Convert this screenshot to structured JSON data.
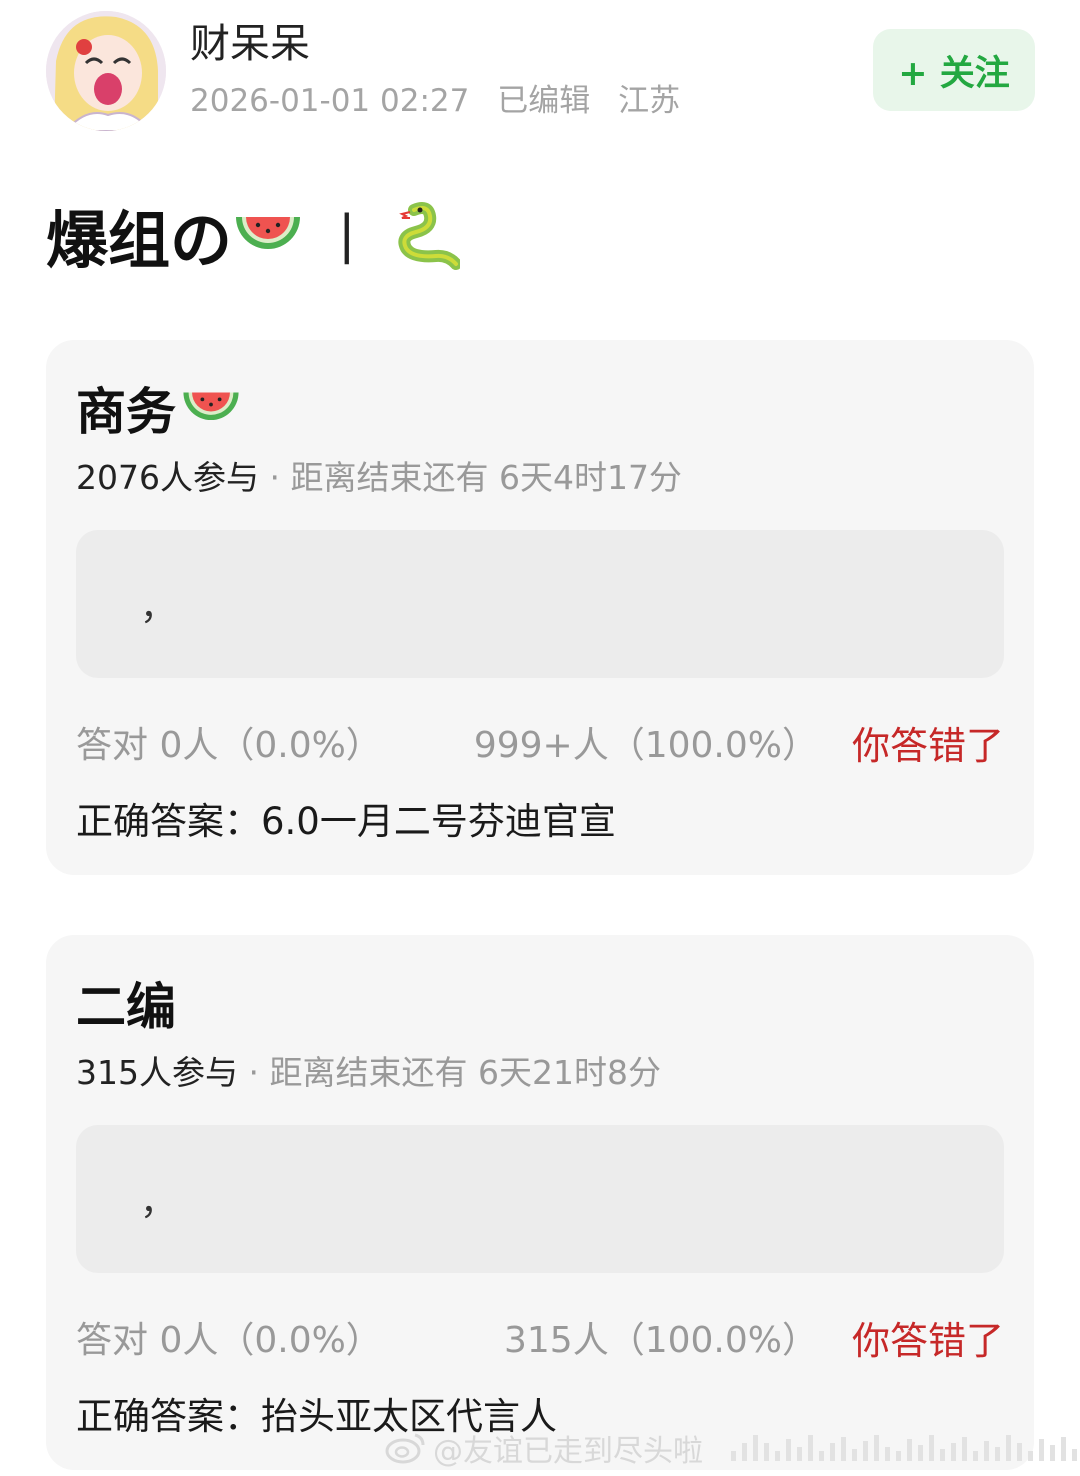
{
  "author": {
    "name": "财呆呆",
    "timestamp": "2026-01-01 02:27",
    "edited_label": "已编辑",
    "location": "江苏",
    "avatar_icon": "anime-girl-avatar"
  },
  "follow_button": {
    "label": "+ 关注",
    "color": "#23a841"
  },
  "post": {
    "title_text": "爆组の",
    "title_icons": [
      "watermelon-emoji",
      "snake-emoji"
    ],
    "separator": "|"
  },
  "quizzes": [
    {
      "title": "商务",
      "title_icon": "watermelon-emoji",
      "participants": "2076人参与",
      "remaining": "· 距离结束还有 6天4时17分",
      "option_text": "，",
      "correct_stat": "答对  0人（0.0%）",
      "wrong_stat": "999+人（100.0%）",
      "wrong_label": "你答错了",
      "answer": "正确答案：6.0一月二号芬迪官宣"
    },
    {
      "title": "二编",
      "title_icon": "",
      "participants": "315人参与",
      "remaining": "· 距离结束还有 6天21时8分",
      "option_text": "，",
      "correct_stat": "答对  0人（0.0%）",
      "wrong_stat": "315人（100.0%）",
      "wrong_label": "你答错了",
      "answer": "正确答案：抬头亚太区代言人"
    }
  ],
  "watermark": {
    "text": "@友谊已走到尽头啦",
    "icon": "weibo-logo"
  },
  "colors": {
    "wrong": "#c62828",
    "card_bg": "#f6f6f6",
    "muted": "#999999"
  }
}
